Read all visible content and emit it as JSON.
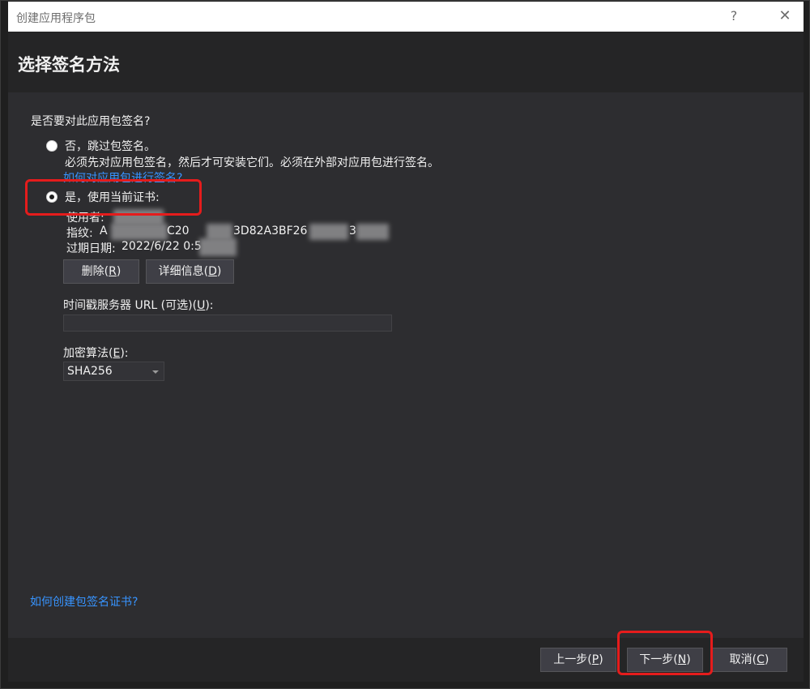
{
  "window": {
    "title": "创建应用程序包",
    "help_glyph": "?",
    "close_glyph": "✕"
  },
  "header": {
    "title": "选择签名方法"
  },
  "main": {
    "question": "是否要对此应用包签名?",
    "option_no": {
      "label": "否，跳过包签名。",
      "description": "必须先对应用包签名，然后才可安装它们。必须在外部对应用包进行签名。",
      "link": "如何对应用包进行签名?",
      "selected": false
    },
    "option_yes": {
      "label": "是，使用当前证书:",
      "selected": true
    },
    "certificate": {
      "issued_to_label": "使用者:",
      "thumbprint_label": "指纹:",
      "thumbprint_visible_start": "A",
      "thumbprint_visible_mid1": "C20",
      "thumbprint_visible_mid2": "3D82A3BF26",
      "thumbprint_visible_end": "3",
      "expiration_label": "过期日期:",
      "expiration_value": "2022/6/22 0:5"
    },
    "buttons": {
      "delete_text": "删除(",
      "delete_key": "R",
      "details_text": "详细信息(",
      "details_key": "D"
    },
    "timestamp": {
      "label_text": "时间戳服务器 URL (可选)(",
      "label_key": "U",
      "label_tail": "):",
      "value": ""
    },
    "encryption": {
      "label_text": "加密算法(",
      "label_key": "E",
      "label_tail": "):",
      "selected": "SHA256"
    },
    "create_cert_link": "如何创建包签名证书?"
  },
  "footer": {
    "prev_text": "上一步(",
    "prev_key": "P",
    "next_text": "下一步(",
    "next_key": "N",
    "cancel_text": "取消(",
    "cancel_key": "C",
    "close_paren": ")"
  },
  "colors": {
    "accent_link": "#3794ff",
    "highlight": "#e51c1c",
    "dialog_bg": "#2d2d30"
  }
}
